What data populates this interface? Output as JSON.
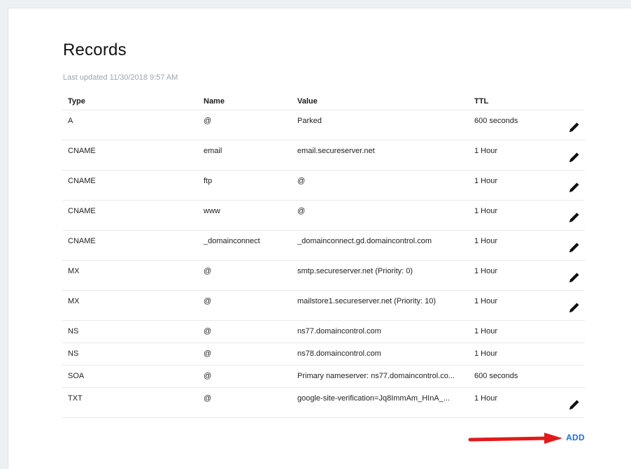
{
  "records": {
    "title": "Records",
    "last_updated": "Last updated 11/30/2018 9:57 AM",
    "columns": {
      "type": "Type",
      "name": "Name",
      "value": "Value",
      "ttl": "TTL"
    },
    "rows": [
      {
        "type": "A",
        "name": "@",
        "value": "Parked",
        "ttl": "600 seconds",
        "editable": true
      },
      {
        "type": "CNAME",
        "name": "email",
        "value": "email.secureserver.net",
        "ttl": "1 Hour",
        "editable": true
      },
      {
        "type": "CNAME",
        "name": "ftp",
        "value": "@",
        "ttl": "1 Hour",
        "editable": true
      },
      {
        "type": "CNAME",
        "name": "www",
        "value": "@",
        "ttl": "1 Hour",
        "editable": true
      },
      {
        "type": "CNAME",
        "name": "_domainconnect",
        "value": "_domainconnect.gd.domaincontrol.com",
        "ttl": "1 Hour",
        "editable": true
      },
      {
        "type": "MX",
        "name": "@",
        "value": "smtp.secureserver.net (Priority: 0)",
        "ttl": "1 Hour",
        "editable": true
      },
      {
        "type": "MX",
        "name": "@",
        "value": "mailstore1.secureserver.net (Priority: 10)",
        "ttl": "1 Hour",
        "editable": true
      },
      {
        "type": "NS",
        "name": "@",
        "value": "ns77.domaincontrol.com",
        "ttl": "1 Hour",
        "editable": false
      },
      {
        "type": "NS",
        "name": "@",
        "value": "ns78.domaincontrol.com",
        "ttl": "1 Hour",
        "editable": false
      },
      {
        "type": "SOA",
        "name": "@",
        "value": "Primary nameserver: ns77.domaincontrol.co...",
        "ttl": "600 seconds",
        "editable": false
      },
      {
        "type": "TXT",
        "name": "@",
        "value": "google-site-verification=Jq8ImmAm_HInA_...",
        "ttl": "1 Hour",
        "editable": true
      }
    ],
    "edit_icon": "pencil-icon",
    "add_label": "ADD"
  },
  "annotation": {
    "arrow_color": "#e01b1b",
    "arrow_icon": "red-arrow-right"
  },
  "colors": {
    "accent": "#1f6fd0",
    "muted_text": "#9aa6b2",
    "divider": "#e7e9eb"
  }
}
